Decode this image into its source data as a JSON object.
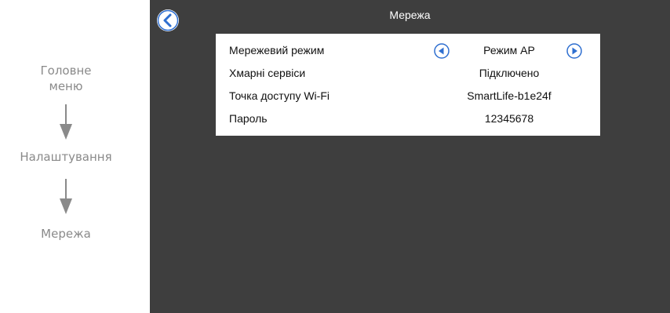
{
  "nav_path": {
    "steps": [
      "Головне\nменю",
      "Налаштування",
      "Мережа"
    ]
  },
  "screen": {
    "title": "Мережа",
    "back_icon": "chevron-left-icon",
    "settings": [
      {
        "label": "Мережевий режим",
        "value": "Режим AP",
        "has_arrows": true
      },
      {
        "label": "Хмарні сервіси",
        "value": "Підключено"
      },
      {
        "label": "Точка доступу Wi-Fi",
        "value": "SmartLife-b1e24f"
      },
      {
        "label": "Пароль",
        "value": "12345678"
      }
    ]
  },
  "colors": {
    "screen_background": "#3e3e3e",
    "panel_background": "#ffffff",
    "accent_blue": "#2f6fd0",
    "nav_gray": "#8a8a8a"
  }
}
